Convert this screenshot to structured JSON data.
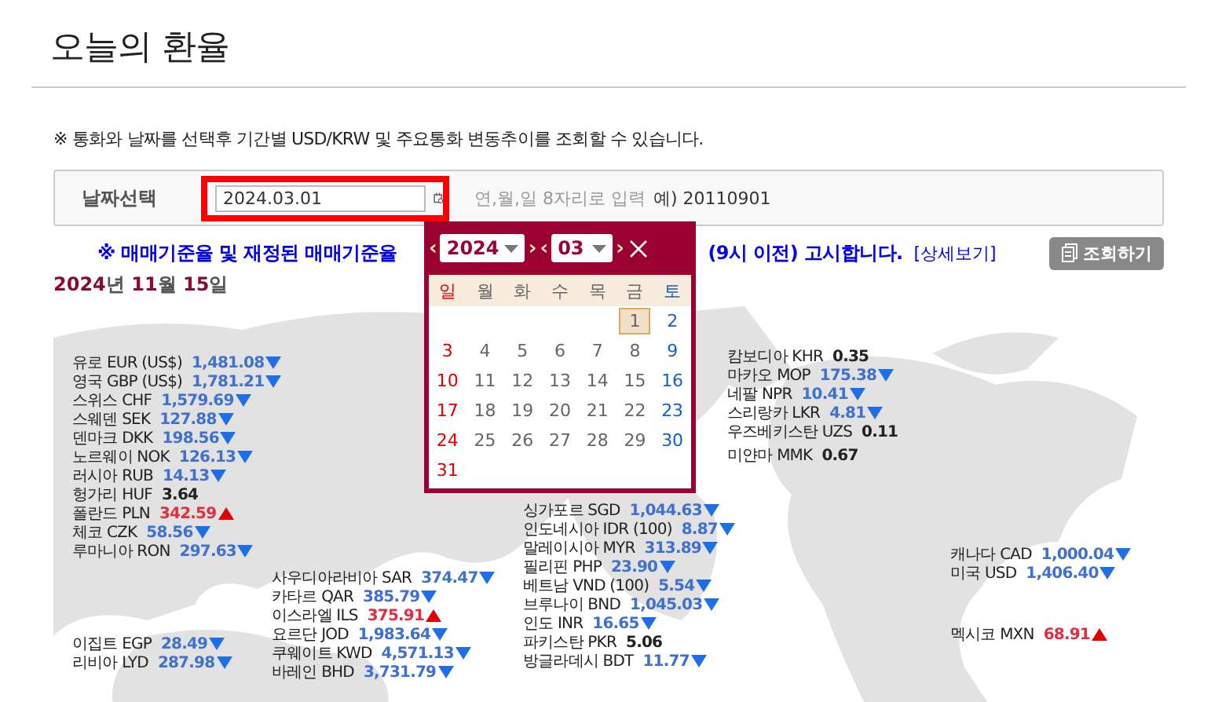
{
  "page_title": "오늘의 환율",
  "guide": "※ 통화와 날짜를 선택후 기간별 USD/KRW 및 주요통화 변동추이를 조회할 수 있습니다.",
  "date_picker": {
    "label": "날짜선택",
    "value": "2024.03.01",
    "hint": "연,월,일 8자리로 입력",
    "example": "예) 20110901"
  },
  "notice": {
    "start": "※ 매매기준율 및 재정된 매매기준율",
    "end": "(9시 이전) 고시합니다.",
    "link": "[상세보기]"
  },
  "search_button": "조회하기",
  "date_display": [
    {
      "text": "2024",
      "kind": "number"
    },
    {
      "text": "년 ",
      "kind": "unit"
    },
    {
      "text": "11",
      "kind": "number"
    },
    {
      "text": "월 ",
      "kind": "unit"
    },
    {
      "text": "15",
      "kind": "number"
    },
    {
      "text": "일",
      "kind": "unit"
    }
  ],
  "map_groups": [
    {
      "items": [
        {
          "name": "유로 EUR (US$)",
          "value": "1,481.08",
          "rising": false,
          "falling": true
        },
        {
          "name": "영국 GBP (US$)",
          "value": "1,781.21",
          "rising": false,
          "falling": true
        },
        {
          "name": "스위스 CHF",
          "value": "1,579.69",
          "rising": false,
          "falling": true
        },
        {
          "name": "스웨덴 SEK",
          "value": "127.88",
          "rising": false,
          "falling": true
        },
        {
          "name": "덴마크 DKK",
          "value": "198.56",
          "rising": false,
          "falling": true
        },
        {
          "name": "노르웨이 NOK",
          "value": "126.13",
          "rising": false,
          "falling": true
        },
        {
          "name": "러시아 RUB",
          "value": "14.13",
          "rising": false,
          "falling": true
        },
        {
          "name": "헝가리 HUF",
          "value": "3.64",
          "rising": false,
          "falling": false
        },
        {
          "name": "폴란드 PLN",
          "value": "342.59",
          "rising": true,
          "falling": false
        },
        {
          "name": "체코 CZK",
          "value": "58.56",
          "rising": false,
          "falling": true
        },
        {
          "name": "루마니아 RON",
          "value": "297.63",
          "rising": false,
          "falling": true
        }
      ]
    },
    {
      "items": [
        {
          "name": "이집트 EGP",
          "value": "28.49",
          "rising": false,
          "falling": true
        },
        {
          "name": "리비아 LYD",
          "value": "287.98",
          "rising": false,
          "falling": true
        }
      ]
    },
    {
      "items": [
        {
          "name": "사우디아라비아 SAR",
          "value": "374.47",
          "rising": false,
          "falling": true
        },
        {
          "name": "카타르 QAR",
          "value": "385.79",
          "rising": false,
          "falling": true
        },
        {
          "name": "이스라엘 ILS",
          "value": "375.91",
          "rising": true,
          "falling": false
        },
        {
          "name": "요르단 JOD",
          "value": "1,983.64",
          "rising": false,
          "falling": true
        },
        {
          "name": "쿠웨이트 KWD",
          "value": "4,571.13",
          "rising": false,
          "falling": true
        },
        {
          "name": "바레인 BHD",
          "value": "3,731.79",
          "rising": false,
          "falling": true
        }
      ]
    },
    {
      "items": [
        {
          "name": "싱가포르 SGD",
          "value": "1,044.63",
          "rising": false,
          "falling": true
        },
        {
          "name": "인도네시아 IDR (100)",
          "value": "8.87",
          "rising": false,
          "falling": true
        },
        {
          "name": "말레이시아 MYR",
          "value": "313.89",
          "rising": false,
          "falling": true
        },
        {
          "name": "필리핀 PHP",
          "value": "23.90",
          "rising": false,
          "falling": true
        },
        {
          "name": "베트남 VND (100)",
          "value": "5.54",
          "rising": false,
          "falling": true
        },
        {
          "name": "브루나이 BND",
          "value": "1,045.03",
          "rising": false,
          "falling": true
        },
        {
          "name": "인도 INR",
          "value": "16.65",
          "rising": false,
          "falling": true
        },
        {
          "name": "파키스탄 PKR",
          "value": "5.06",
          "rising": false,
          "falling": false
        },
        {
          "name": "방글라데시 BDT",
          "value": "11.77",
          "rising": false,
          "falling": true
        }
      ]
    },
    {
      "items": [
        {
          "name": "캄보디아 KHR",
          "value": "0.35",
          "rising": false,
          "falling": false
        },
        {
          "name": "마카오 MOP",
          "value": "175.38",
          "rising": false,
          "falling": true
        },
        {
          "name": "네팔 NPR",
          "value": "10.41",
          "rising": false,
          "falling": true
        },
        {
          "name": "스리랑카 LKR",
          "value": "4.81",
          "rising": false,
          "falling": true
        },
        {
          "name": "우즈베키스탄 UZS",
          "value": "0.11",
          "rising": false,
          "falling": false
        },
        {
          "name": "미얀마 MMK",
          "value": "0.67",
          "rising": false,
          "falling": false
        }
      ]
    },
    {
      "items": [
        {
          "name": "캐나다 CAD",
          "value": "1,000.04",
          "rising": false,
          "falling": true
        },
        {
          "name": "미국 USD",
          "value": "1,406.40",
          "rising": false,
          "falling": true
        }
      ]
    },
    {
      "items": [
        {
          "name": "멕시코 MXN",
          "value": "68.91",
          "rising": true,
          "falling": false
        }
      ]
    }
  ],
  "calendar": {
    "prev_year": "‹",
    "year": "2024",
    "next_year": "›",
    "prev_month": "‹",
    "month": "03",
    "next_month": "›",
    "weekdays": [
      "일",
      "월",
      "화",
      "수",
      "목",
      "금",
      "토"
    ],
    "days": [
      {
        "label": "1",
        "selected": true
      },
      {
        "label": "2",
        "selected": false
      },
      {
        "label": "3",
        "selected": false
      },
      {
        "label": "4",
        "selected": false
      },
      {
        "label": "5",
        "selected": false
      },
      {
        "label": "6",
        "selected": false
      },
      {
        "label": "7",
        "selected": false
      },
      {
        "label": "8",
        "selected": false
      },
      {
        "label": "9",
        "selected": false
      },
      {
        "label": "10",
        "selected": false
      },
      {
        "label": "11",
        "selected": false
      },
      {
        "label": "12",
        "selected": false
      },
      {
        "label": "13",
        "selected": false
      },
      {
        "label": "14",
        "selected": false
      },
      {
        "label": "15",
        "selected": false
      },
      {
        "label": "16",
        "selected": false
      },
      {
        "label": "17",
        "selected": false
      },
      {
        "label": "18",
        "selected": false
      },
      {
        "label": "19",
        "selected": false
      },
      {
        "label": "20",
        "selected": false
      },
      {
        "label": "21",
        "selected": false
      },
      {
        "label": "22",
        "selected": false
      },
      {
        "label": "23",
        "selected": false
      },
      {
        "label": "24",
        "selected": false
      },
      {
        "label": "25",
        "selected": false
      },
      {
        "label": "26",
        "selected": false
      },
      {
        "label": "27",
        "selected": false
      },
      {
        "label": "28",
        "selected": false
      },
      {
        "label": "29",
        "selected": false
      },
      {
        "label": "30",
        "selected": false
      },
      {
        "label": "31",
        "selected": false
      }
    ]
  }
}
